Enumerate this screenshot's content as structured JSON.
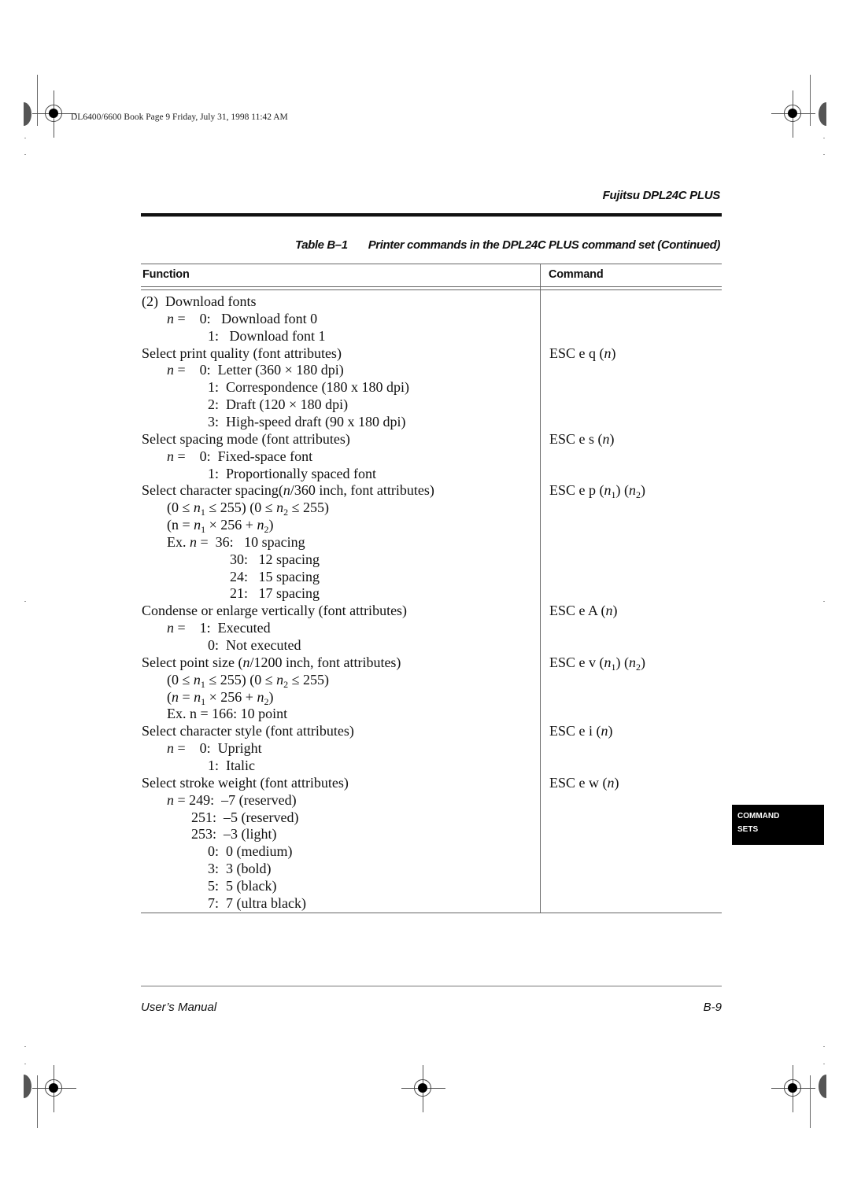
{
  "slug": "DL6400/6600 Book  Page 9  Friday, July 31, 1998  11:42 AM",
  "header": {
    "title": "Fujitsu DPL24C PLUS"
  },
  "table": {
    "caption_number": "Table B–1",
    "caption_text": "Printer commands in the DPL24C PLUS command set (Continued)",
    "columns": [
      "Function",
      "Command"
    ],
    "function_lines": [
      {
        "html": "(2)&nbsp;&nbsp;Download fonts"
      },
      {
        "html": "<i>n</i> =&nbsp;&nbsp;&nbsp;&nbsp;0:&nbsp;&nbsp;&nbsp;Download font 0"
      },
      {
        "html": "1:&nbsp;&nbsp;&nbsp;Download font 1"
      },
      {
        "html": "Select print quality (font attributes)"
      },
      {
        "html": "<i>n</i> =&nbsp;&nbsp;&nbsp;&nbsp;0:&nbsp;&nbsp;Letter (360 × 180 dpi)"
      },
      {
        "html": "1:&nbsp;&nbsp;Correspondence (180 x 180 dpi)"
      },
      {
        "html": "2:&nbsp;&nbsp;Draft (120 × 180 dpi)"
      },
      {
        "html": "3:&nbsp;&nbsp;High-speed draft (90 x 180 dpi)"
      },
      {
        "html": "Select spacing mode (font attributes)"
      },
      {
        "html": "<i>n</i> =&nbsp;&nbsp;&nbsp;&nbsp;0:&nbsp;&nbsp;Fixed-space font"
      },
      {
        "html": "1:&nbsp;&nbsp;Proportionally spaced font"
      },
      {
        "html": "Select character spacing(<i>n</i>/360 inch, font attributes)"
      },
      {
        "html": "(0 ≤ <i>n</i><sub>1</sub> ≤ 255) (0 ≤ <i>n</i><sub>2</sub> ≤ 255)"
      },
      {
        "html": "(n = <i>n</i><sub>1</sub> × 256 + <i>n</i><sub>2</sub>)"
      },
      {
        "html": "Ex. <i>n</i> =&nbsp;&nbsp;36:&nbsp;&nbsp;&nbsp;10 spacing"
      },
      {
        "html": "30:&nbsp;&nbsp;&nbsp;12 spacing"
      },
      {
        "html": "24:&nbsp;&nbsp;&nbsp;15 spacing"
      },
      {
        "html": "21:&nbsp;&nbsp;&nbsp;17 spacing"
      },
      {
        "html": "Condense or enlarge vertically (font attributes)"
      },
      {
        "html": "<i>n</i> =&nbsp;&nbsp;&nbsp;&nbsp;1:&nbsp;&nbsp;Executed"
      },
      {
        "html": "0:&nbsp;&nbsp;Not executed"
      },
      {
        "html": "Select point size (<i>n</i>/1200 inch, font attributes)"
      },
      {
        "html": "(0 ≤ <i>n</i><sub>1</sub> ≤ 255) (0 ≤ <i>n</i><sub>2</sub> ≤ 255)"
      },
      {
        "html": "(<i>n</i> = <i>n</i><sub>1</sub> × 256 + <i>n</i><sub>2</sub>)"
      },
      {
        "html": "Ex. n = 166: 10 point"
      },
      {
        "html": "Select character style (font attributes)"
      },
      {
        "html": "<i>n</i> =&nbsp;&nbsp;&nbsp;&nbsp;0:&nbsp;&nbsp;Upright"
      },
      {
        "html": "1:&nbsp;&nbsp;Italic"
      },
      {
        "html": "Select stroke weight (font attributes)"
      },
      {
        "html": "<i>n</i> = 249:&nbsp;&nbsp;–7 (reserved)"
      },
      {
        "html": "251:&nbsp;&nbsp;–5 (reserved)"
      },
      {
        "html": "253:&nbsp;&nbsp;–3 (light)"
      },
      {
        "html": "0:&nbsp;&nbsp;0 (medium)"
      },
      {
        "html": "3:&nbsp;&nbsp;3 (bold)"
      },
      {
        "html": "5:&nbsp;&nbsp;5 (black)"
      },
      {
        "html": "7:&nbsp;&nbsp;7 (ultra black)"
      }
    ],
    "commands": [
      {
        "row": 3,
        "html": "ESC e q (<i>n</i>)"
      },
      {
        "row": 8,
        "html": "ESC e s (<i>n</i>)"
      },
      {
        "row": 11,
        "html": "ESC e p (<i>n</i><sub>1</sub>) (<i>n</i><sub>2</sub>)"
      },
      {
        "row": 18,
        "html": "ESC e A (<i>n</i>)"
      },
      {
        "row": 21,
        "html": "ESC e v (<i>n</i><sub>1</sub>) (<i>n</i><sub>2</sub>)"
      },
      {
        "row": 25,
        "html": "ESC e i (<i>n</i>)"
      },
      {
        "row": 28,
        "html": "ESC e w (<i>n</i>)"
      }
    ]
  },
  "side_tab": {
    "line1": "COMMAND",
    "line2": "SETS"
  },
  "footer": {
    "left": "User’s Manual",
    "right": "B-9"
  }
}
